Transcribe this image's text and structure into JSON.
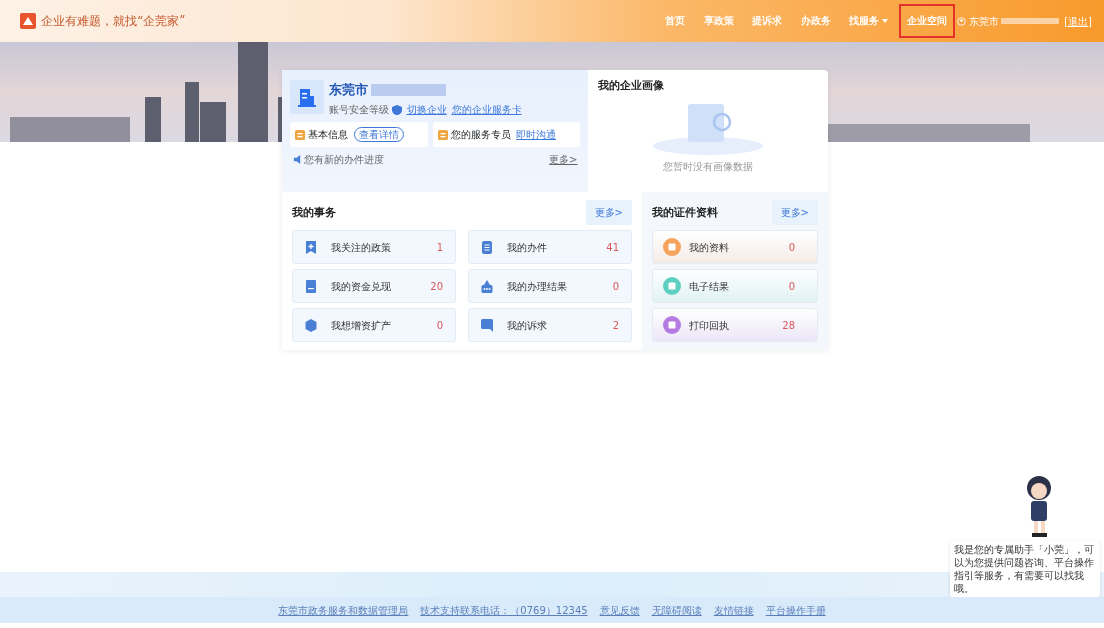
{
  "header": {
    "logo_text": "企业有难题，就找“企莞家”",
    "nav": [
      {
        "label": "首页",
        "selected": false,
        "has_dropdown": false
      },
      {
        "label": "享政策",
        "selected": false,
        "has_dropdown": false
      },
      {
        "label": "提诉求",
        "selected": false,
        "has_dropdown": false
      },
      {
        "label": "办政务",
        "selected": false,
        "has_dropdown": false
      },
      {
        "label": "找服务",
        "selected": false,
        "has_dropdown": true
      },
      {
        "label": "企业空间",
        "selected": true,
        "has_dropdown": false
      }
    ],
    "user": {
      "name": "东莞市",
      "logout": "[退出]"
    }
  },
  "company": {
    "name": "东莞市",
    "security_label": "账号安全等级",
    "links": [
      "切换企业",
      "您的企业服务卡"
    ],
    "info": [
      {
        "label": "基本信息",
        "action": "查看详情",
        "kind": "pill"
      },
      {
        "label": "您的服务专员",
        "action": "即时沟通",
        "kind": "link"
      }
    ],
    "notice": "您有新的办件进度",
    "more": "更多>"
  },
  "portrait": {
    "title": "我的企业画像",
    "empty_text": "您暂时没有画像数据"
  },
  "affairs": {
    "title": "我的事务",
    "more": "更多>",
    "items": [
      {
        "label": "我关注的政策",
        "count": "1"
      },
      {
        "label": "我的办件",
        "count": "41"
      },
      {
        "label": "我的资金兑现",
        "count": "20"
      },
      {
        "label": "我的办理结果",
        "count": "0"
      },
      {
        "label": "我想增资扩产",
        "count": "0"
      },
      {
        "label": "我的诉求",
        "count": "2"
      }
    ]
  },
  "certificates": {
    "title": "我的证件资料",
    "more": "更多>",
    "items": [
      {
        "label": "我的资料",
        "count": "0",
        "color": "#f5a25d"
      },
      {
        "label": "电子结果",
        "count": "0",
        "color": "#5fd0c0"
      },
      {
        "label": "打印回执",
        "count": "28",
        "color": "#b47be0"
      }
    ]
  },
  "assistant": {
    "message": "我是您的专属助手「小莞」，可以为您提供问题咨询、平台操作指引等服务，有需要可以找我哦。"
  },
  "footer": {
    "links": [
      "东莞市政务服务和数据管理局",
      "技术支持联系电话：（0769）12345",
      "意见反馈",
      "无障碍阅读",
      "友情链接",
      "平台操作手册"
    ]
  }
}
